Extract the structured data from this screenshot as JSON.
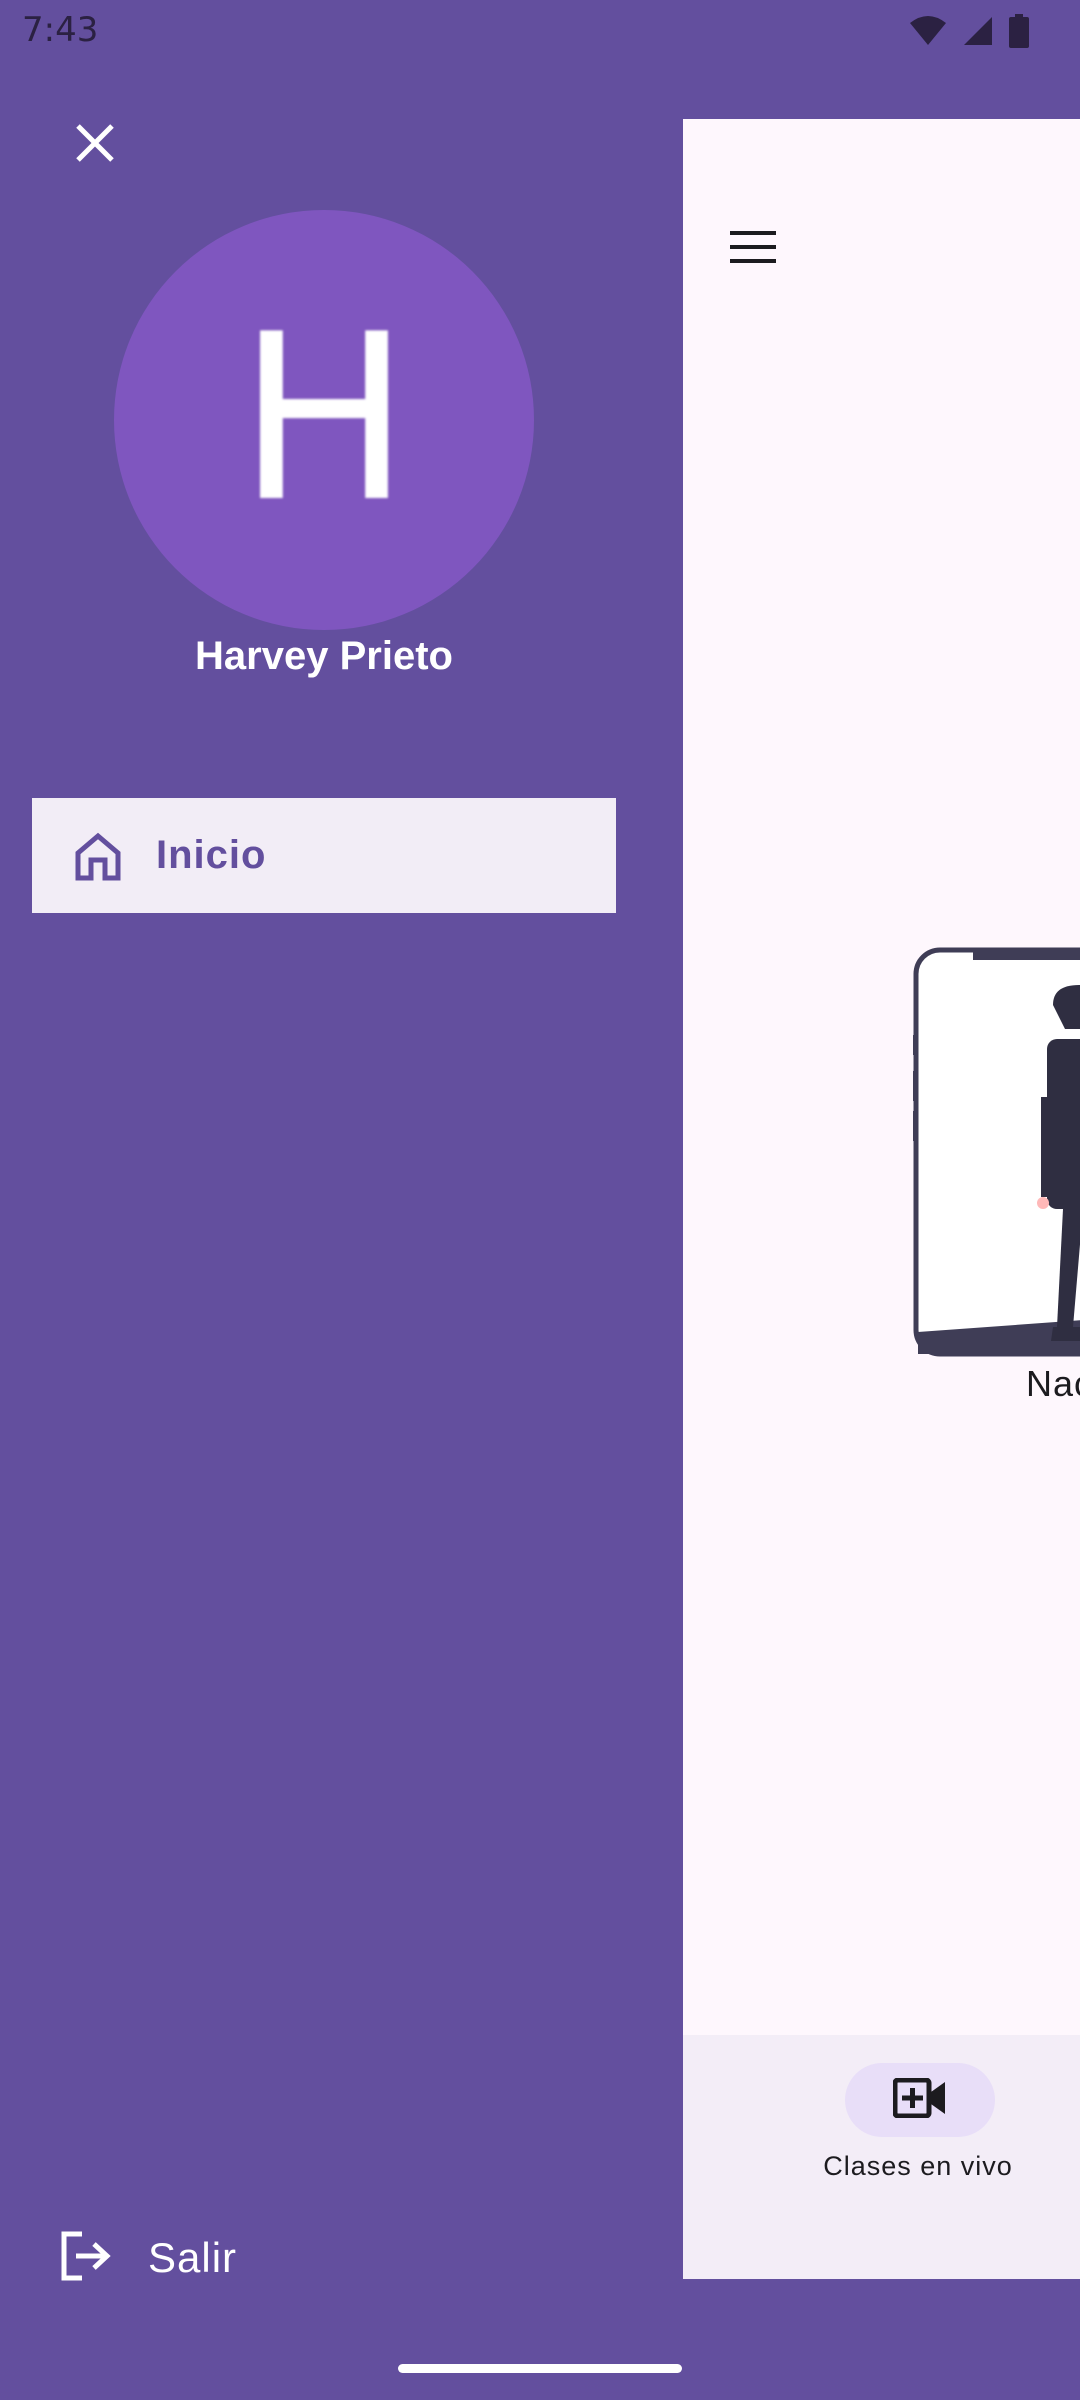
{
  "status_bar": {
    "time": "7:43"
  },
  "drawer": {
    "user_initial": "H",
    "user_name": "Harvey Prieto",
    "items": [
      {
        "label": "Inicio",
        "icon": "home-icon",
        "selected": true
      }
    ],
    "logout_label": "Salir"
  },
  "main": {
    "illustration_caption": "Nac",
    "bottom_nav": {
      "label": "Clases en vivo",
      "icon": "video-add-icon"
    }
  },
  "colors": {
    "drawer_bg": "#634f9e",
    "avatar_bg": "#7f56bf",
    "selected_item_bg": "#f2edf6",
    "main_bg": "#fef7fd",
    "bottom_nav_bg": "#f3edf7",
    "nav_pill_bg": "#e8def8"
  }
}
